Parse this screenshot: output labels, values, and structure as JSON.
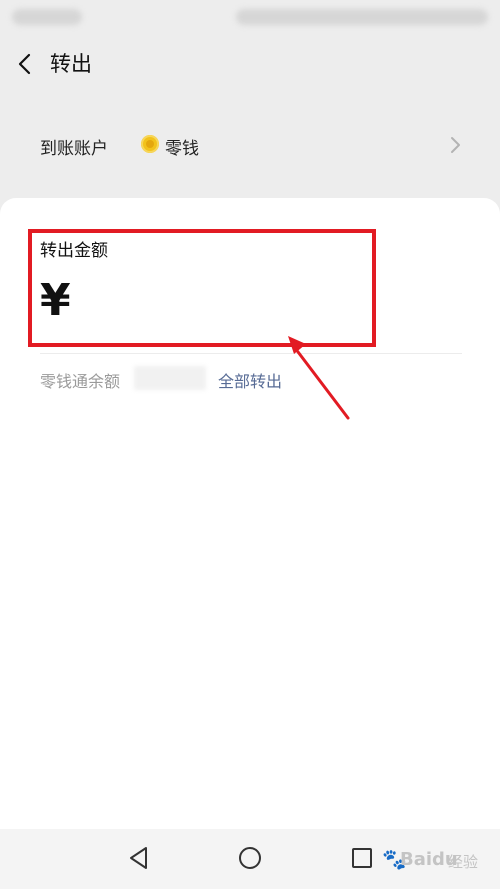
{
  "header": {
    "title": "转出",
    "back_icon": "chevron-left-icon"
  },
  "account": {
    "label": "到账账户",
    "value": "零钱",
    "icon": "coin-icon",
    "chevron_icon": "chevron-right-icon"
  },
  "amount": {
    "label": "转出金额",
    "currency": "¥",
    "value": ""
  },
  "balance": {
    "label": "零钱通余额",
    "action": "全部转出"
  },
  "nav": {
    "back_icon": "triangle-back-icon",
    "home_icon": "circle-home-icon",
    "recent_icon": "square-recent-icon"
  },
  "watermark": {
    "paw": "🐾",
    "brand": "Baidu",
    "sub": "经验"
  },
  "colors": {
    "background": "#ededed",
    "card": "#ffffff",
    "link": "#576b95",
    "highlight": "#e21b23",
    "coin": "#f2c21b"
  }
}
